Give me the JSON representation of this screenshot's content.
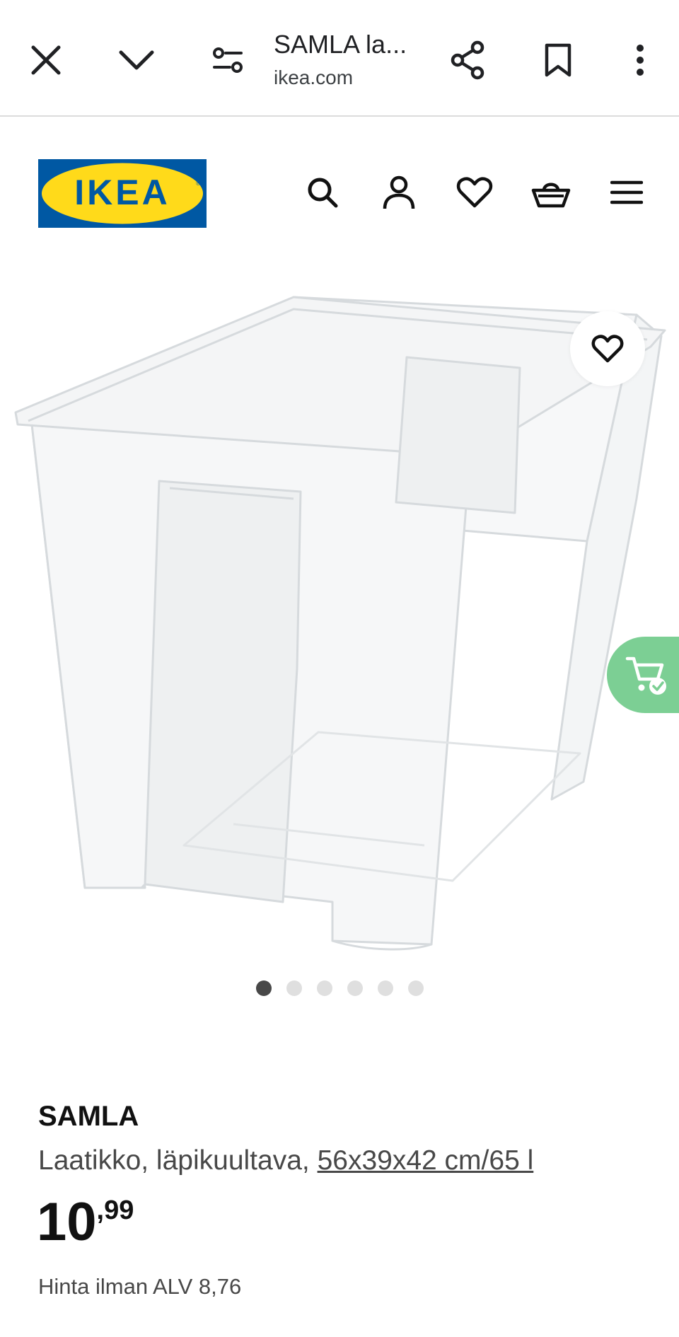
{
  "browser": {
    "tab_title": "SAMLA la...",
    "url": "ikea.com"
  },
  "header": {
    "logo_text": "IKEA",
    "logo_colors": {
      "background": "#0058a3",
      "oval": "#ffda1a",
      "text": "#0058a3"
    }
  },
  "icons": {
    "close": "close-icon",
    "collapse": "chevron-down-icon",
    "site_settings": "tune-icon",
    "share": "share-icon",
    "bookmark": "bookmark-icon",
    "more": "more-vert-icon",
    "search": "search-icon",
    "account": "user-icon",
    "wishlist": "heart-icon",
    "basket": "basket-icon",
    "menu": "hamburger-menu-icon",
    "favorite": "heart-icon",
    "added_to_cart": "cart-check-icon"
  },
  "carousel": {
    "total_images": 6,
    "active_index": 0
  },
  "product": {
    "name": "SAMLA",
    "description": "Laatikko, läpikuultava, ",
    "dimensions": "56x39x42 cm/65 l",
    "price_integer": "10",
    "price_decimal": ",99",
    "price_without_vat": "Hinta ilman ALV 8,76"
  },
  "colors": {
    "cart_float_bg": "#7ccf94",
    "dot_active": "#484848",
    "dot_inactive": "#dfdfdf"
  }
}
